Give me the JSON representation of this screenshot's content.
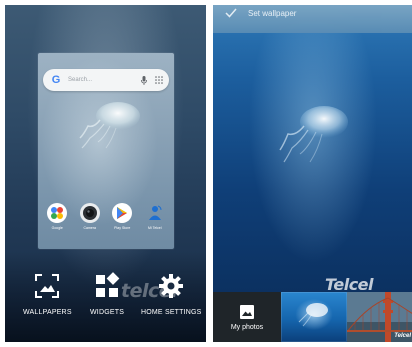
{
  "left_screen": {
    "search": {
      "placeholder": "Search..."
    },
    "apps": [
      {
        "label": "Google",
        "icon": "google-icon"
      },
      {
        "label": "Camera",
        "icon": "camera-icon"
      },
      {
        "label": "Play Store",
        "icon": "play-store-icon"
      },
      {
        "label": "Mi Telcel",
        "icon": "mi-telcel-icon"
      }
    ],
    "actions": [
      {
        "label": "WALLPAPERS",
        "icon": "wallpapers-icon"
      },
      {
        "label": "WIDGETS",
        "icon": "widgets-icon"
      },
      {
        "label": "HOME SETTINGS",
        "icon": "gear-icon"
      }
    ],
    "watermark": "telcel"
  },
  "right_screen": {
    "top_bar": {
      "label": "Set wallpaper"
    },
    "watermark": "Telcel",
    "bottom_strip": {
      "my_photos_label": "My photos",
      "bridge_watermark": "Telcel"
    }
  },
  "colors": {
    "left_bg": "#2e4a66",
    "right_bg": "#1c5e9e",
    "preview_bg": "#8aa2b6",
    "google_blue": "#4285f4",
    "play_green": "#34a853"
  }
}
